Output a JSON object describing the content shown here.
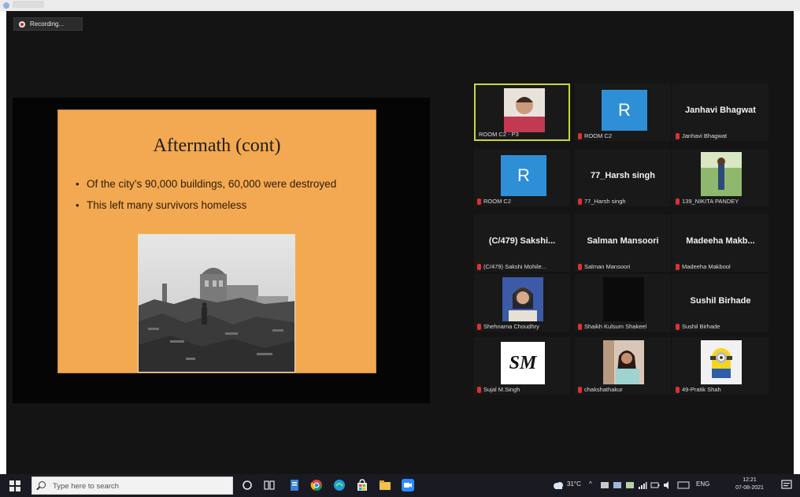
{
  "window": {
    "recording_label": "Recording..."
  },
  "slide": {
    "title": "Aftermath (cont)",
    "bullets": [
      "Of the city’s 90,000 buildings, 60,000 were destroyed",
      "This left many survivors homeless"
    ]
  },
  "gallery": {
    "tiles": [
      {
        "name": "ROOM C2 - P3"
      },
      {
        "name": "ROOM C2",
        "avatar_letter": "R"
      },
      {
        "name": "Janhavi Bhagwat",
        "display_name": "Janhavi Bhagwat"
      },
      {
        "name": "ROOM C2",
        "avatar_letter": "R"
      },
      {
        "name": "77_Harsh singh",
        "display_name": "77_Harsh singh"
      },
      {
        "name": "139_NIKITA PANDEY"
      },
      {
        "name": "(C/479) Sakshi Mohile...",
        "display_name": "(C/479) Sakshi..."
      },
      {
        "name": "Salman Mansoori",
        "display_name": "Salman Mansoori"
      },
      {
        "name": "Madeeha Makbool",
        "display_name": "Madeeha Makb..."
      },
      {
        "name": "Shehnama Choudhry"
      },
      {
        "name": "Shaikh Kulsum Shakeel"
      },
      {
        "name": "Sushil Birhade",
        "display_name": "Sushil Birhade"
      },
      {
        "name": "Sujal M.Singh",
        "avatar_text": "SM"
      },
      {
        "name": "chakshathakur"
      },
      {
        "name": "49-Pratik Shah"
      }
    ]
  },
  "taskbar": {
    "search_placeholder": "Type here to search",
    "weather": "31°C",
    "language": "ENG",
    "time": "12:21",
    "date": "07-08-2021"
  },
  "colors": {
    "slide_bg": "#f3a951",
    "active_speaker_border": "#c9d63a",
    "avatar_blue": "#2e8fd6",
    "mic_muted": "#e03030",
    "taskbar_bg": "#1a1b22"
  }
}
